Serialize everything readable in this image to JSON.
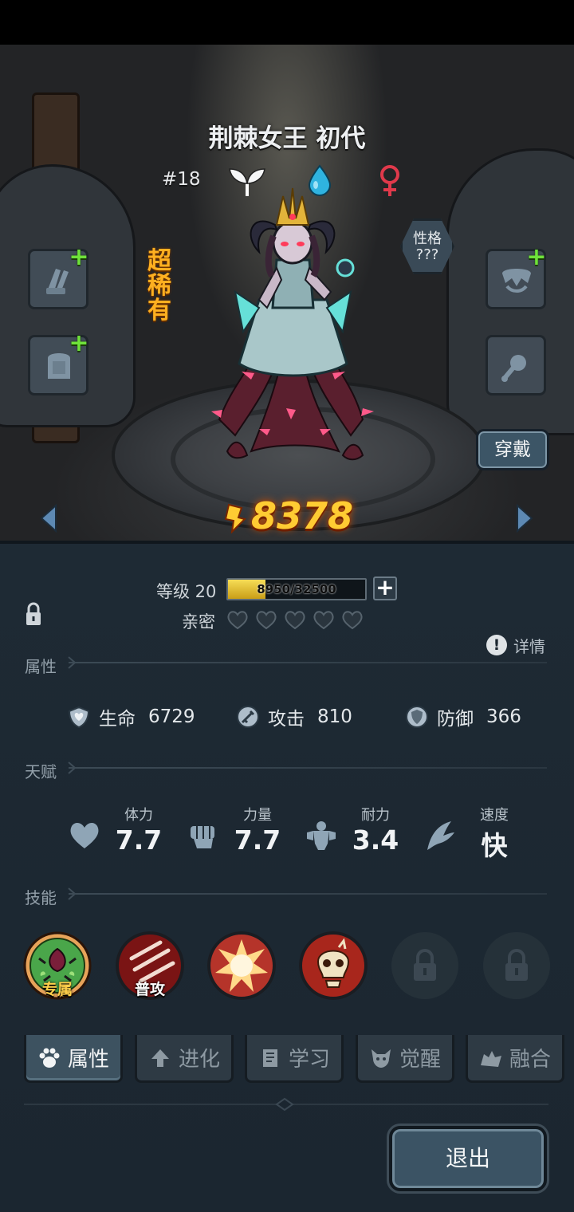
{
  "character": {
    "name": "荆棘女王 初代",
    "number": "#18",
    "rarity": "超稀有",
    "personality_label": "性格",
    "personality_value": "???",
    "power": "8378",
    "equip_button": "穿戴"
  },
  "level": {
    "label": "等级 20",
    "xp_text": "8950/32500",
    "xp_fraction": 0.275,
    "intimacy_label": "亲密",
    "intimacy_hearts_filled": 0,
    "intimacy_hearts_total": 5
  },
  "detail_label": "详情",
  "sections": {
    "attributes": "属性",
    "talents": "天赋",
    "skills": "技能"
  },
  "stats": [
    {
      "label": "生命",
      "value": "6729",
      "icon": "heart-shield-icon"
    },
    {
      "label": "攻击",
      "value": "810",
      "icon": "sword-icon"
    },
    {
      "label": "防御",
      "value": "366",
      "icon": "shield-icon"
    }
  ],
  "talents": [
    {
      "label": "体力",
      "value": "7.7",
      "icon": "heart-icon"
    },
    {
      "label": "力量",
      "value": "7.7",
      "icon": "fist-icon"
    },
    {
      "label": "耐力",
      "value": "3.4",
      "icon": "muscle-icon"
    },
    {
      "label": "速度",
      "value": "快",
      "icon": "wing-icon"
    }
  ],
  "skills": [
    {
      "tag": "专属",
      "icon": "thorn-rose-skill-icon",
      "locked": false
    },
    {
      "tag": "普攻",
      "icon": "claw-slash-skill-icon",
      "locked": false
    },
    {
      "tag": "",
      "icon": "explosion-skill-icon",
      "locked": false
    },
    {
      "tag": "",
      "icon": "skull-skill-icon",
      "locked": false
    },
    {
      "tag": "",
      "icon": "lock-icon",
      "locked": true
    },
    {
      "tag": "",
      "icon": "lock-icon",
      "locked": true
    }
  ],
  "tabs": [
    {
      "label": "属性",
      "icon": "paw-icon",
      "active": true
    },
    {
      "label": "进化",
      "icon": "arrow-up-icon",
      "active": false
    },
    {
      "label": "学习",
      "icon": "book-icon",
      "active": false
    },
    {
      "label": "觉醒",
      "icon": "beast-head-icon",
      "active": false
    },
    {
      "label": "融合",
      "icon": "fusion-icon",
      "active": false
    }
  ],
  "exit_button": "退出",
  "colors": {
    "rarity": "#ffb020",
    "power": "#ffcc33",
    "xp_fill": "#e8c230",
    "panel_bg": "#1e2a34",
    "plus_green": "#6fe23a"
  }
}
